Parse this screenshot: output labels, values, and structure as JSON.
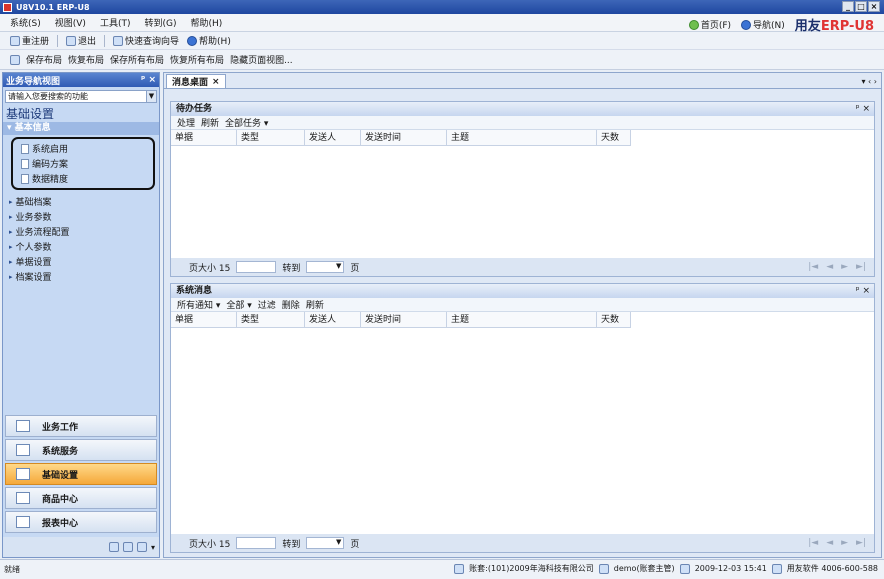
{
  "window": {
    "title": "U8V10.1 ERP-U8",
    "controls": [
      "_",
      "□",
      "×"
    ]
  },
  "menu": {
    "items": [
      "系统(S)",
      "视图(V)",
      "工具(T)",
      "转到(G)",
      "帮助(H)"
    ],
    "right": {
      "home": "首页(F)",
      "nav": "导航(N)",
      "brand_a": "用友",
      "brand_b": "ERP-U8"
    }
  },
  "toolbar1": {
    "items": [
      "重注册",
      "退出",
      "快速查询向导",
      "帮助(H)"
    ]
  },
  "toolbar2": {
    "items": [
      "保存布局",
      "恢复布局",
      "保存所有布局",
      "恢复所有布局",
      "隐藏页面视图..."
    ]
  },
  "nav": {
    "header": "业务导航视图",
    "pin": "ᵖ ×",
    "select_placeholder": "请输入您要搜索的功能",
    "title": "基础设置",
    "group": "基本信息",
    "sub_items": [
      "系统启用",
      "编码方案",
      "数据精度"
    ],
    "tree": [
      "基础档案",
      "业务参数",
      "业务流程配置",
      "个人参数",
      "单据设置",
      "档案设置"
    ],
    "buttons": [
      "业务工作",
      "系统服务",
      "基础设置",
      "商品中心",
      "报表中心"
    ],
    "active_button": 2
  },
  "main": {
    "tab": "消息桌面",
    "tab_close": "×",
    "tab_ctl": "▾ ‹ ›",
    "panel1": {
      "title": "待办任务",
      "close": "ᵖ ×",
      "tools": [
        "处理",
        "刷新",
        "全部任务 ▾"
      ],
      "columns": [
        "单据",
        "类型",
        "发送人",
        "发送时间",
        "主题",
        "天数"
      ]
    },
    "panel2": {
      "title": "系统消息",
      "close": "ᵖ ×",
      "tools": [
        "所有通知 ▾",
        "全部 ▾",
        "过滤",
        "删除",
        "刷新"
      ],
      "columns": [
        "单据",
        "类型",
        "发送人",
        "发送时间",
        "主题",
        "天数"
      ]
    },
    "footer": {
      "page_size": "页大小 15",
      "goto": "转到",
      "page": "页",
      "pager": [
        "|◄",
        "◄",
        "►",
        "►|"
      ]
    }
  },
  "status": {
    "left": "就绪",
    "account": "账套:(101)2009年海科技有限公司",
    "user": "demo(账套主管)",
    "date": "2009-12-03 15:41",
    "company": "用友软件 4006-600-588"
  }
}
